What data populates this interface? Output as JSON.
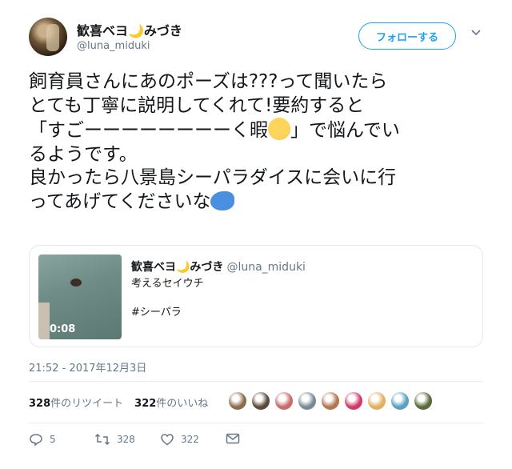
{
  "user": {
    "display_name": "歓喜ベヨ🌙みづき",
    "handle": "@luna_miduki",
    "follow_label": "フォローする"
  },
  "tweet": {
    "line1": "飼育員さんにあのポーズは???って聞いたら",
    "line2": "とても丁寧に説明してくれて!要約すると",
    "line3a": "「すごーーーーーーーーく暇",
    "line3b": "」で悩んでい",
    "line4": "るようです。",
    "line5": "良かったら八景島シーパラダイスに会いに行",
    "line6": "ってあげてくださいな",
    "emoji_1": "thinking-face",
    "emoji_2": "dolphin"
  },
  "quoted": {
    "display_name": "歓喜ベヨ🌙みづき",
    "handle": "@luna_miduki",
    "text": "考えるセイウチ",
    "hashtag": "#シーパラ",
    "duration": "0:08"
  },
  "timestamp": "21:52 - 2017年12月3日",
  "stats": {
    "retweets_count": "328",
    "retweets_label": "件のリツイート",
    "likes_count": "322",
    "likes_label": "件のいいね"
  },
  "likers": [
    "#8b6b4a",
    "#5a4a3a",
    "#c86b6b",
    "#7a8a95",
    "#b07850",
    "#d23a6a",
    "#e0b060",
    "#5aa0c0",
    "#5a6a3a"
  ],
  "actions": {
    "reply_count": "5",
    "retweet_count": "328",
    "like_count": "322"
  },
  "colors": {
    "accent": "#1da1f2",
    "muted": "#657786"
  }
}
